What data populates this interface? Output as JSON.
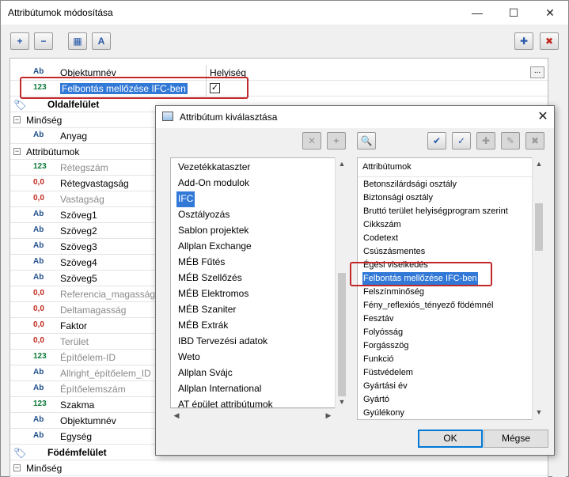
{
  "window": {
    "title": "Attribútumok módosítása",
    "min_glyph": "—",
    "max_glyph": "☐",
    "close_glyph": "✕"
  },
  "toolbar": {
    "icons": [
      "expand-icon",
      "collapse-icon",
      "attribute-icon",
      "attribute-text-icon",
      "add-favorite-icon",
      "remove-favorite-icon"
    ],
    "glyphs": {
      "expand": "+",
      "collapse": "−",
      "attr1": "▦",
      "attr2": "A",
      "fav_add": "✚",
      "fav_remove": "✖"
    }
  },
  "attribute_list": {
    "top_rows": [
      {
        "type": "Ab",
        "name": "Objektumnév",
        "value": "Helyiség"
      },
      {
        "type": "123",
        "name": "Felbontás mellőzése IFC-ben",
        "checked": true,
        "check_glyph": "✓"
      }
    ],
    "ellipsis": "...",
    "sections": [
      {
        "label": "Oldalfelület"
      },
      {
        "label": "Födémfelület"
      }
    ],
    "groups": {
      "quality": "Minőség",
      "attributes": "Attribútumok",
      "quality2": "Minőség",
      "expander": "−"
    },
    "quality_rows": [
      {
        "type": "Ab",
        "name": "Anyag"
      }
    ],
    "attribute_rows": [
      {
        "type": "123",
        "name": "Rétegszám",
        "grey": true
      },
      {
        "type": "0,0",
        "name": "Rétegvastagság",
        "grey": false
      },
      {
        "type": "0,0",
        "name": "Vastagság",
        "grey": true
      },
      {
        "type": "Ab",
        "name": "Szöveg1",
        "grey": false
      },
      {
        "type": "Ab",
        "name": "Szöveg2",
        "grey": false
      },
      {
        "type": "Ab",
        "name": "Szöveg3",
        "grey": false
      },
      {
        "type": "Ab",
        "name": "Szöveg4",
        "grey": false
      },
      {
        "type": "Ab",
        "name": "Szöveg5",
        "grey": false
      },
      {
        "type": "0,0",
        "name": "Referencia_magasság",
        "grey": true
      },
      {
        "type": "0,0",
        "name": "Deltamagasság",
        "grey": true
      },
      {
        "type": "0,0",
        "name": "Faktor",
        "grey": false
      },
      {
        "type": "0,0",
        "name": "Terület",
        "grey": true
      },
      {
        "type": "123",
        "name": "Építőelem-ID",
        "grey": true
      },
      {
        "type": "Ab",
        "name": "Allright_építőelem_ID",
        "grey": true
      },
      {
        "type": "Ab",
        "name": "Építőelemszám",
        "grey": true
      },
      {
        "type": "123",
        "name": "Szakma",
        "grey": false
      },
      {
        "type": "Ab",
        "name": "Objektumnév",
        "grey": false
      },
      {
        "type": "Ab",
        "name": "Egység",
        "grey": false
      }
    ]
  },
  "dialog": {
    "title": "Attribútum kiválasztása",
    "close_glyph": "✕",
    "toolbar_glyphs": [
      "✕",
      "+",
      "🔍",
      "✔",
      "✓",
      "✚",
      "✎",
      "✖"
    ],
    "left_list": [
      "Vezetékkataszter",
      "Add-On modulok",
      "IFC",
      "Osztályozás",
      "Sablon projektek",
      "Allplan Exchange",
      "MÉB Fűtés",
      "MÉB Szellőzés",
      "MÉB Elektromos",
      "MÉB Szaniter",
      "MÉB Extrák",
      "IBD Tervezési adatok",
      "Weto",
      "Allplan Svájc",
      "Allplan International",
      "AT épület attribútumok"
    ],
    "left_selected": "IFC",
    "right_header": "Attribútumok",
    "right_list": [
      "Betonszilárdsági osztály",
      "Biztonsági osztály",
      "Bruttó terület helyiségprogram szerint",
      "Cikkszám",
      "Codetext",
      "Csúszásmentes",
      "Égési viselkedés",
      "Felbontás mellőzése IFC-ben",
      "Felszínminőség",
      "Fény_reflexiós_tényező födémnél",
      "Fesztáv",
      "Folyósság",
      "Forgásszög",
      "Funkció",
      "Füstvédelem",
      "Gyártási év",
      "Gyártó",
      "Gyúlékony"
    ],
    "right_selected": "Felbontás mellőzése IFC-ben",
    "ok_label": "OK",
    "cancel_label": "Mégse",
    "scroll_up": "▲",
    "scroll_down": "▼",
    "scroll_left": "◀",
    "scroll_right": "▶"
  },
  "colors": {
    "selection": "#3279d7",
    "highlight_box": "#c0282a",
    "type_ab": "#1f4f8a",
    "type_123": "#0d7a3a",
    "type_00": "#c0281e"
  }
}
